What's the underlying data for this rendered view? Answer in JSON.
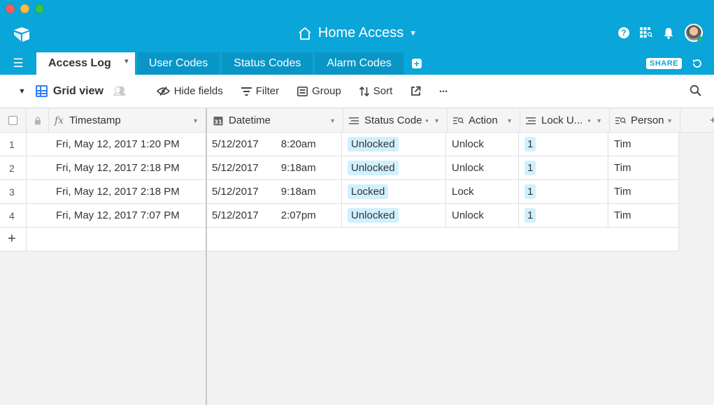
{
  "window": {
    "title": "Home Access"
  },
  "header": {
    "base_title": "Home Access",
    "icons": [
      "help-icon",
      "apps-icon",
      "bell-icon",
      "avatar"
    ]
  },
  "tabs": [
    {
      "label": "Access Log",
      "active": true
    },
    {
      "label": "User Codes"
    },
    {
      "label": "Status Codes"
    },
    {
      "label": "Alarm Codes"
    }
  ],
  "share_label": "SHARE",
  "toolbar": {
    "view_name": "Grid view",
    "hide_fields": "Hide fields",
    "filter": "Filter",
    "group": "Group",
    "sort": "Sort",
    "more": "•••"
  },
  "columns": {
    "timestamp": "Timestamp",
    "datetime": "Datetime",
    "status_code": "Status Code",
    "action": "Action",
    "lock_user": "Lock U...",
    "person": "Person"
  },
  "rows": [
    {
      "num": "1",
      "timestamp": "Fri, May 12, 2017 1:20 PM",
      "date": "5/12/2017",
      "time": "8:20am",
      "status": "Unlocked",
      "action": "Unlock",
      "lock_user": "1",
      "person": "Tim"
    },
    {
      "num": "2",
      "timestamp": "Fri, May 12, 2017 2:18 PM",
      "date": "5/12/2017",
      "time": "9:18am",
      "status": "Unlocked",
      "action": "Unlock",
      "lock_user": "1",
      "person": "Tim"
    },
    {
      "num": "3",
      "timestamp": "Fri, May 12, 2017 2:18 PM",
      "date": "5/12/2017",
      "time": "9:18am",
      "status": "Locked",
      "action": "Lock",
      "lock_user": "1",
      "person": "Tim"
    },
    {
      "num": "4",
      "timestamp": "Fri, May 12, 2017 7:07 PM",
      "date": "5/12/2017",
      "time": "2:07pm",
      "status": "Unlocked",
      "action": "Unlock",
      "lock_user": "1",
      "person": "Tim"
    }
  ],
  "colors": {
    "brand": "#0aa5d9",
    "pill": "#d0f0fd",
    "accent": "#2d7ff9"
  }
}
